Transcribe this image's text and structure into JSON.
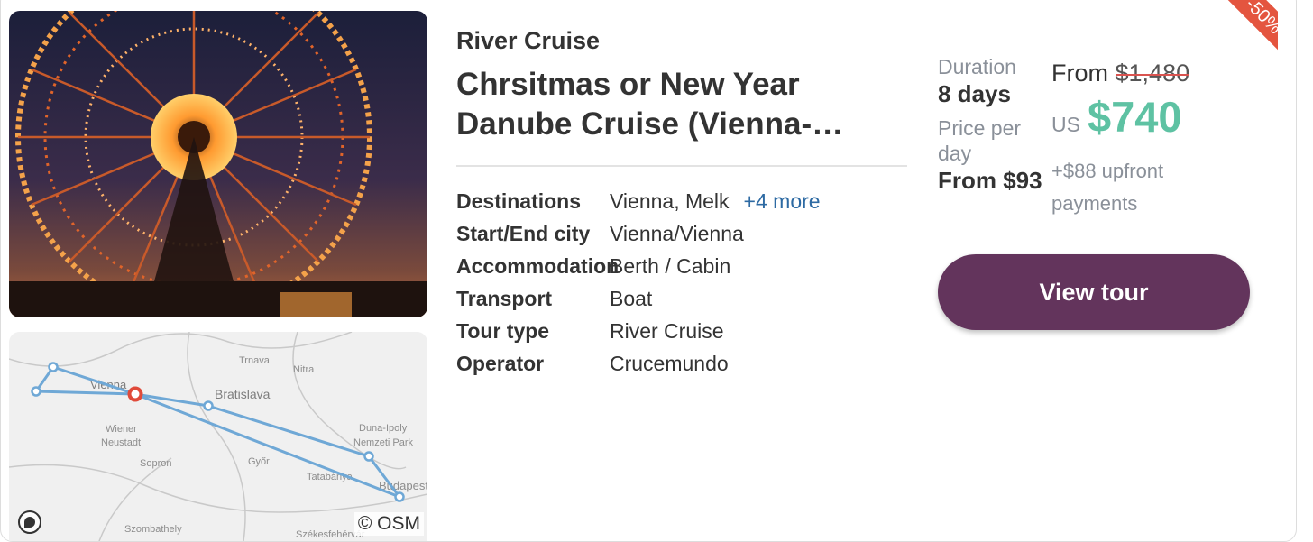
{
  "tour": {
    "category": "River Cruise",
    "title": "Chrsitmas or New Year Danube Cruise (Vienna-…",
    "discount_badge": "-50%",
    "images": {
      "photo_icon": "ferris-wheel-photo",
      "map_icon": "route-map"
    },
    "map": {
      "attribution": "© OSM",
      "labels": [
        "Trnava",
        "Nitra",
        "Vienna",
        "Bratislava",
        "Wiener Neustadt",
        "Sopron",
        "Győr",
        "Tatabánya",
        "Duna-Ipoly Nemzeti Park",
        "Budapest",
        "Szombathely",
        "Székesfehérvár"
      ]
    },
    "details": [
      {
        "label": "Destinations",
        "value": "Vienna, Melk",
        "extra": "+4 more"
      },
      {
        "label": "Start/End city",
        "value": "Vienna/Vienna"
      },
      {
        "label": "Accommodation",
        "value": "Berth / Cabin"
      },
      {
        "label": "Transport",
        "value": "Boat"
      },
      {
        "label": "Tour type",
        "value": "River Cruise"
      },
      {
        "label": "Operator",
        "value": "Crucemundo"
      }
    ],
    "duration": {
      "label": "Duration",
      "value": "8 days"
    },
    "price_per_day": {
      "label": "Price per day",
      "value": "From $93"
    },
    "pricing": {
      "from_label": "From",
      "original_price": "$1,480",
      "currency": "US",
      "price": "$740",
      "upfront": "+$88 upfront payments"
    },
    "cta": {
      "label": "View tour"
    },
    "colors": {
      "price": "#5ec2a3",
      "button": "#63345c",
      "badge": "#e4553f",
      "link": "#2d6aa3"
    }
  }
}
